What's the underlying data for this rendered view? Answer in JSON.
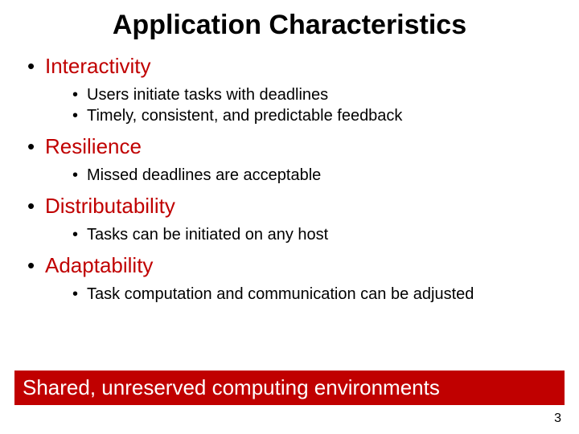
{
  "title": "Application Characteristics",
  "bullets": [
    {
      "heading": "Interactivity",
      "subs": [
        "Users initiate tasks with deadlines",
        "Timely, consistent, and predictable feedback"
      ]
    },
    {
      "heading": "Resilience",
      "subs": [
        "Missed deadlines are acceptable"
      ]
    },
    {
      "heading": "Distributability",
      "subs": [
        "Tasks can be initiated on any host"
      ]
    },
    {
      "heading": "Adaptability",
      "subs": [
        "Task computation and communication can be adjusted"
      ]
    }
  ],
  "banner": "Shared, unreserved computing environments",
  "page_number": "3"
}
